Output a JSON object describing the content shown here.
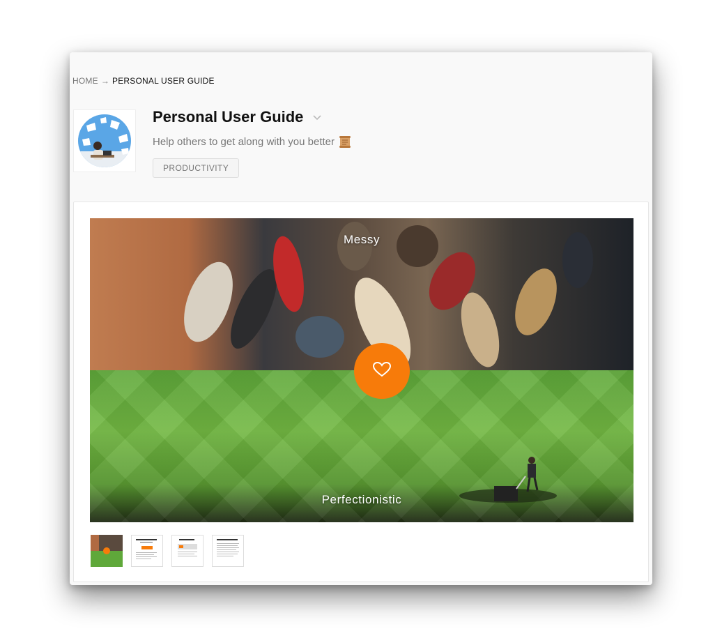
{
  "breadcrumb": {
    "home": "HOME",
    "separator": "→",
    "current": "PERSONAL USER GUIDE"
  },
  "header": {
    "title": "Personal User Guide",
    "subtitle": "Help others to get along with you better",
    "tag": "PRODUCTIVITY"
  },
  "slide": {
    "top_label": "Messy",
    "bottom_label": "Perfectionistic"
  },
  "icons": {
    "dropdown": "chevron-down-icon",
    "subtitle_emoji": "scroll-icon",
    "like": "heart-icon"
  },
  "thumbnails": [
    {
      "name": "thumbnail-1",
      "active": true
    },
    {
      "name": "thumbnail-2",
      "active": false
    },
    {
      "name": "thumbnail-3",
      "active": false
    },
    {
      "name": "thumbnail-4",
      "active": false
    }
  ],
  "colors": {
    "accent": "#f77b0a",
    "window_bg": "#f9f9f9"
  }
}
